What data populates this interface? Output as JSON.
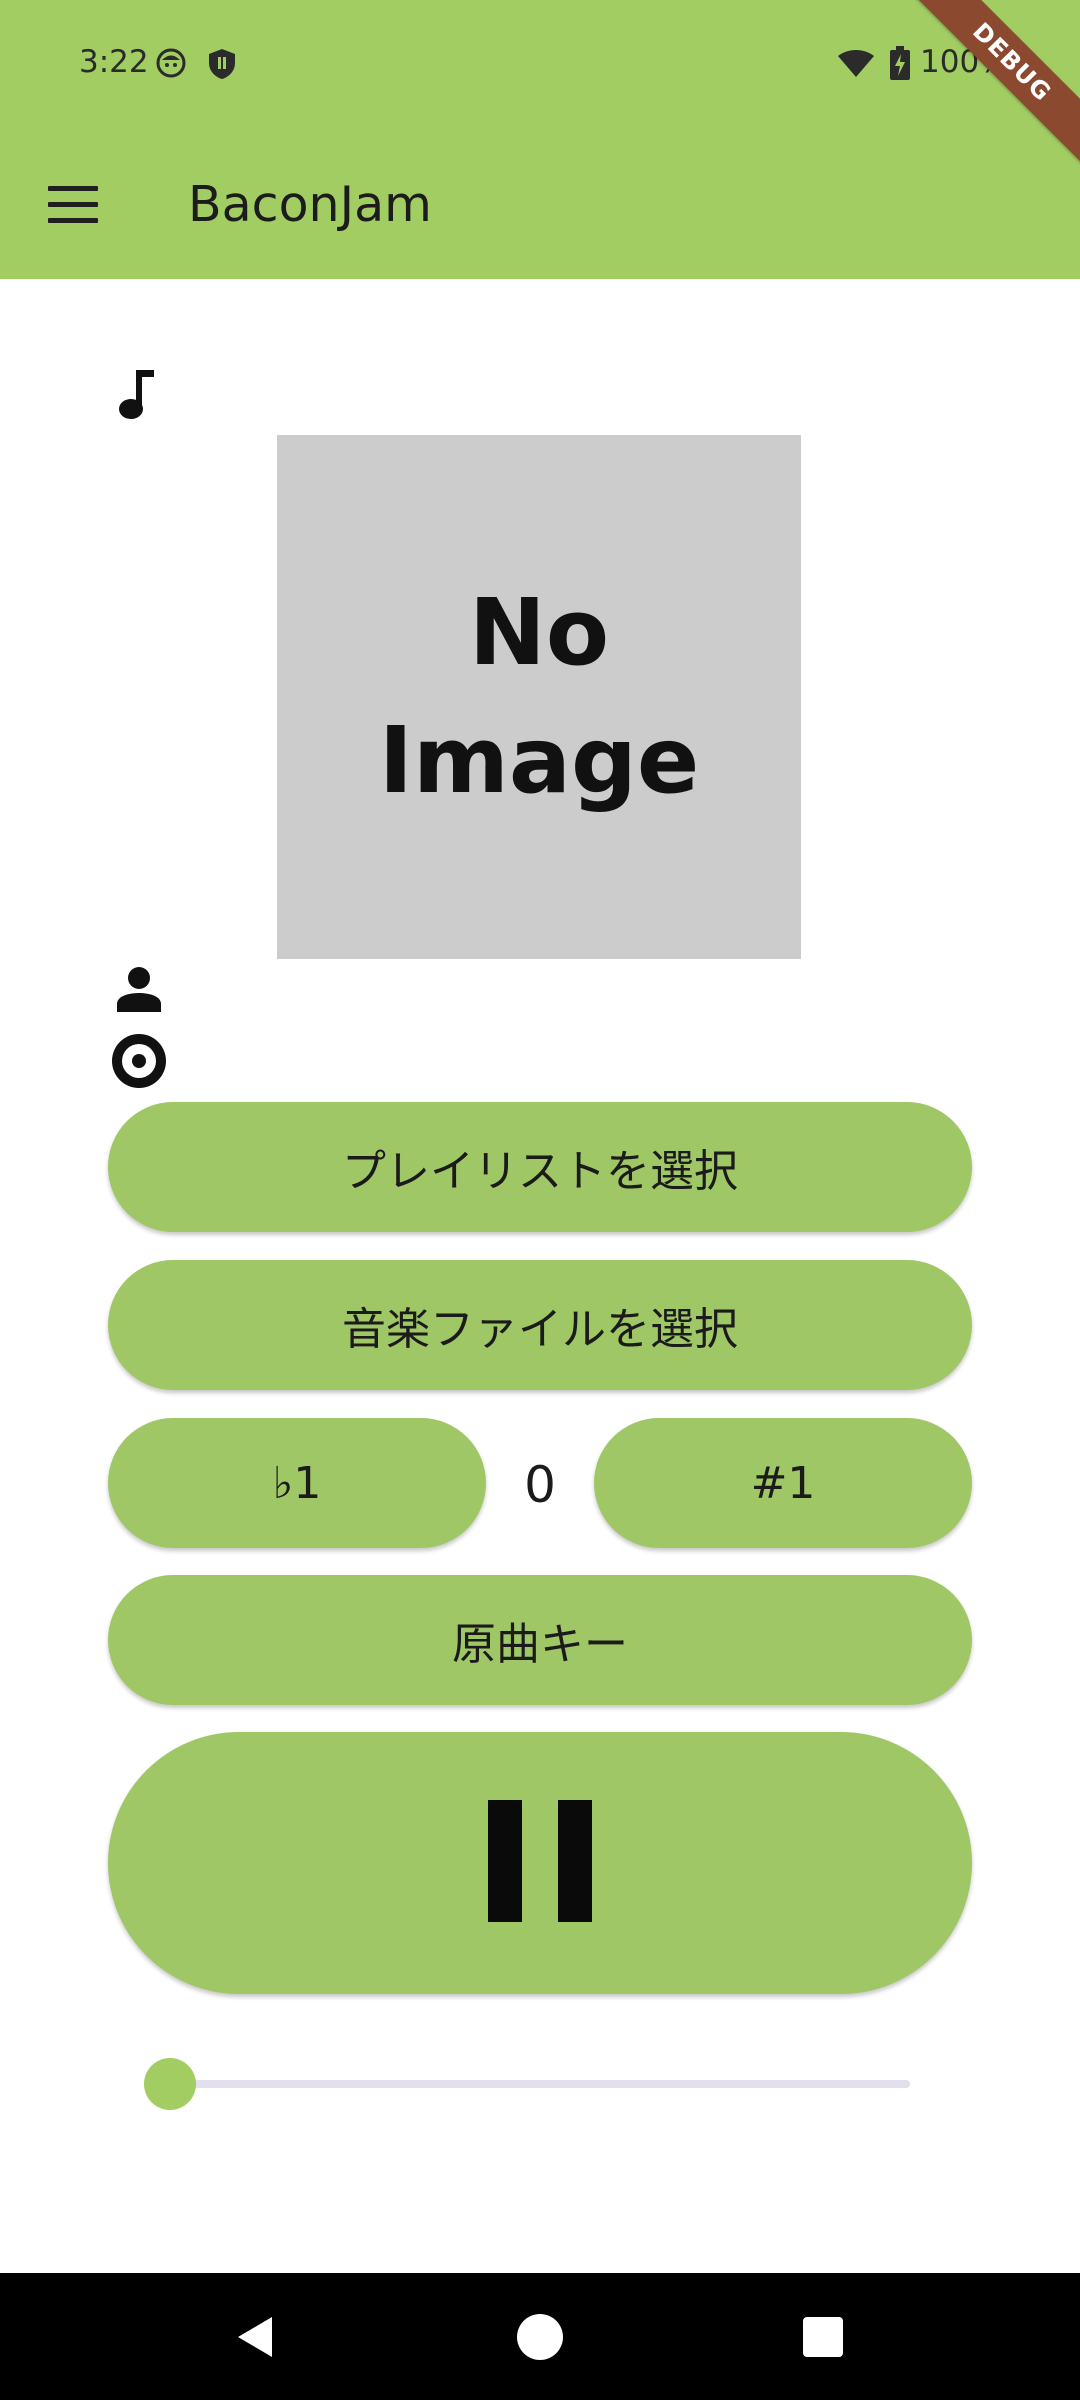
{
  "status_bar": {
    "time": "3:22",
    "battery": "100%",
    "icons": [
      "face-icon",
      "shield-icon",
      "wifi-icon",
      "battery-icon"
    ]
  },
  "debug_banner": "DEBUG",
  "app_bar": {
    "title": "BaconJam",
    "menu_icon": "menu-icon"
  },
  "track_info": {
    "song_icon": "music-note-icon",
    "artwork_text_line1": "No",
    "artwork_text_line2": "Image",
    "artist_icon": "person-icon",
    "album_icon": "disc-icon"
  },
  "buttons": {
    "select_playlist": "プレイリストを選択",
    "select_music_file": "音楽ファイルを選択",
    "flat": "♭1",
    "pitch_value": "0",
    "sharp": "#1",
    "original_key": "原曲キー",
    "play_pause_icon": "pause-icon"
  },
  "slider": {
    "position": 0
  },
  "colors": {
    "primary": "#a2cd62",
    "button": "#9fc765",
    "slider_track": "#e4dfec",
    "debug_ribbon": "#8b4a2f"
  },
  "nav_bar": {
    "icons": [
      "back-icon",
      "home-icon",
      "recents-icon"
    ]
  }
}
